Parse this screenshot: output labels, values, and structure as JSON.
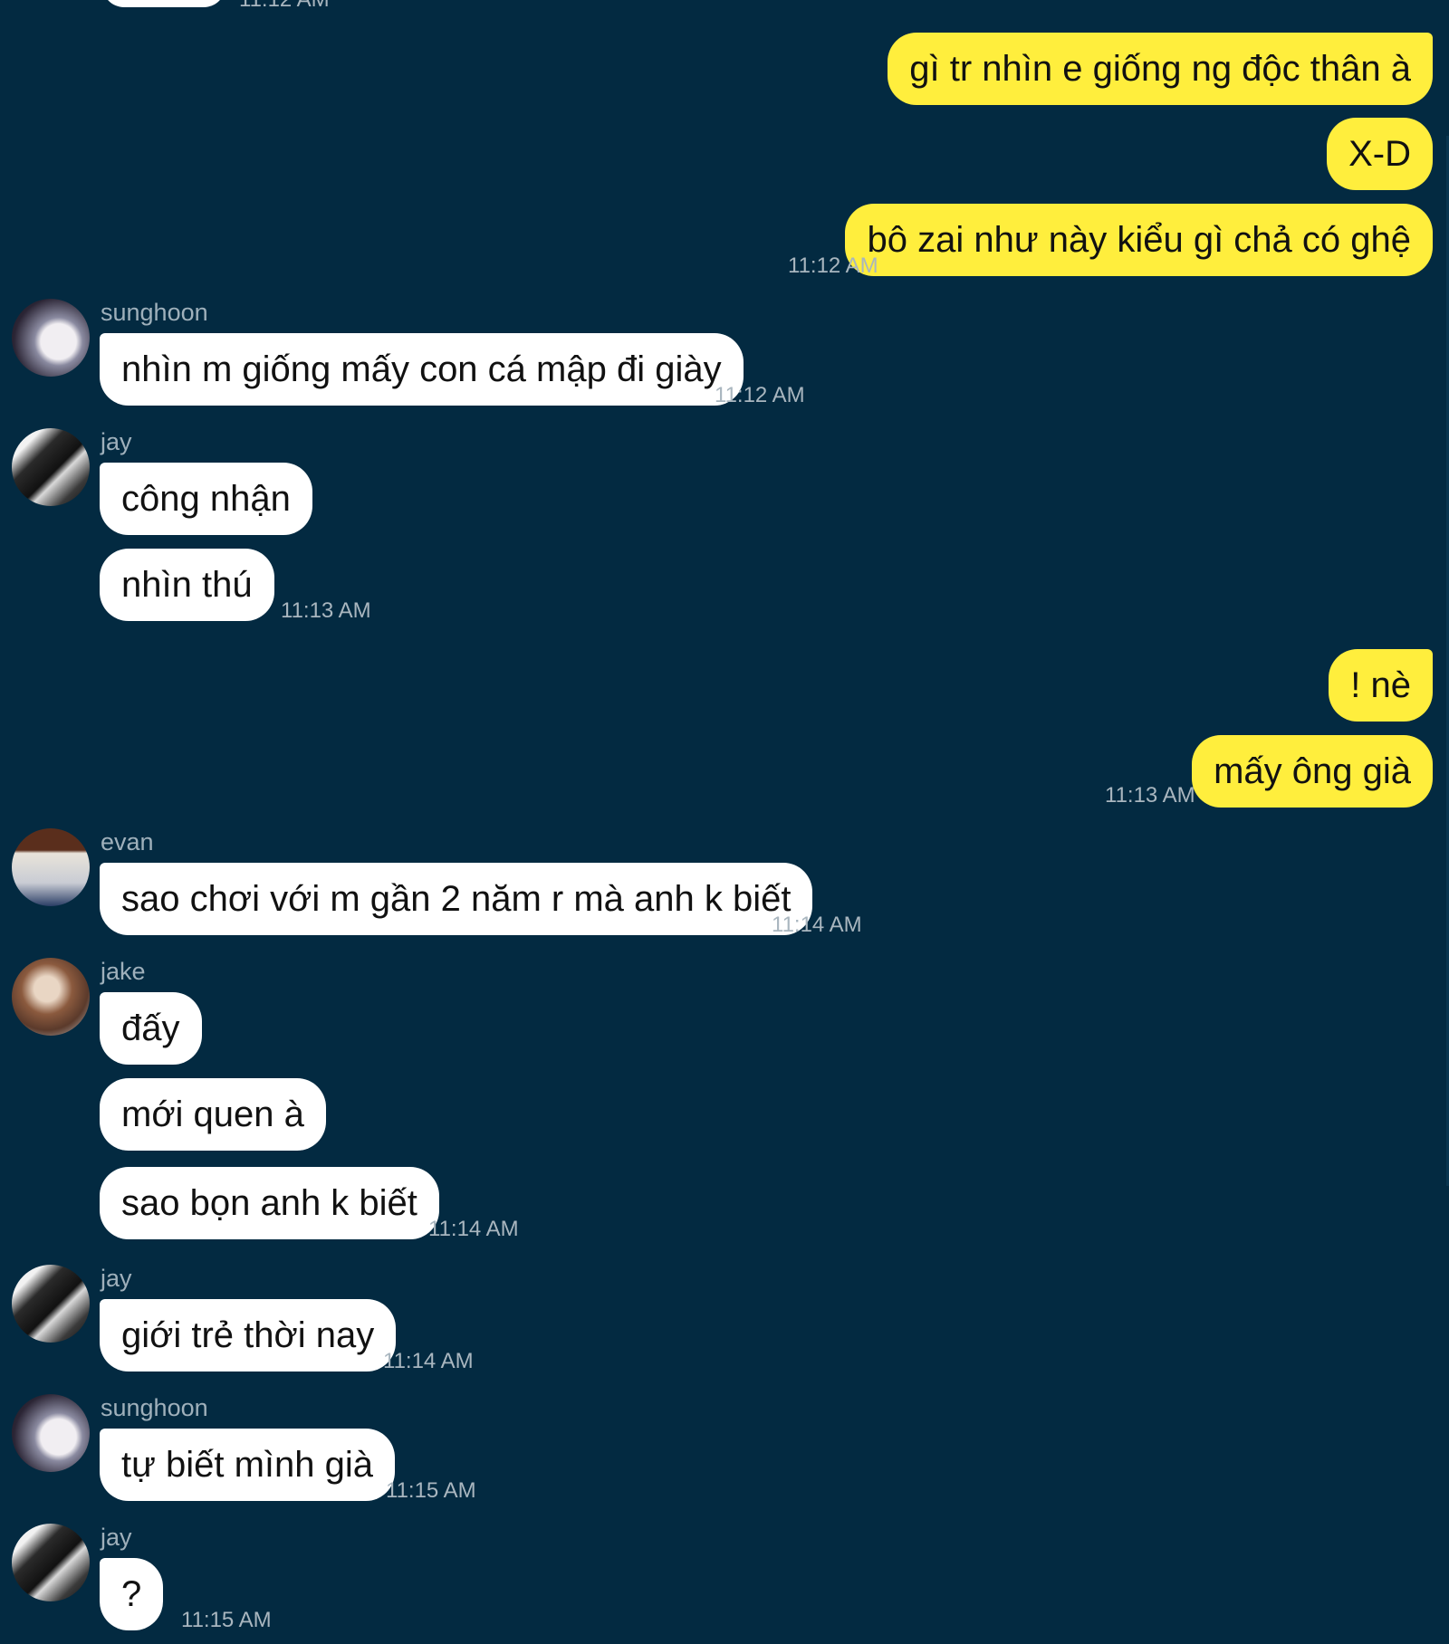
{
  "top_partial": {
    "time": "11:12 AM"
  },
  "messages": [
    {
      "side": "out",
      "text": "gì tr nhìn e giống ng độc thân à"
    },
    {
      "side": "out",
      "text": "X-D"
    },
    {
      "side": "out",
      "text": "bô zai như này kiểu gì chả có ghệ",
      "time": "11:12 AM"
    },
    {
      "side": "in",
      "sender": "sunghoon",
      "text": "nhìn m giống mấy con cá mập đi giày",
      "time": "11:12 AM"
    },
    {
      "side": "in",
      "sender": "jay",
      "text": "công nhận"
    },
    {
      "side": "in",
      "text": "nhìn thú",
      "time": "11:13 AM"
    },
    {
      "side": "out",
      "text": "! nè"
    },
    {
      "side": "out",
      "text": "mấy ông già",
      "time": "11:13 AM"
    },
    {
      "side": "in",
      "sender": "evan",
      "text": "sao chơi với m gần 2 năm r mà anh k biết",
      "time": "11:14 AM"
    },
    {
      "side": "in",
      "sender": "jake",
      "text": "đấy"
    },
    {
      "side": "in",
      "text": "mới quen à"
    },
    {
      "side": "in",
      "text": "sao bọn anh k biết",
      "time": "11:14 AM"
    },
    {
      "side": "in",
      "sender": "jay",
      "text": "giới trẻ thời nay",
      "time": "11:14 AM"
    },
    {
      "side": "in",
      "sender": "sunghoon",
      "text": "tự biết mình già",
      "time": "11:15 AM"
    },
    {
      "side": "in",
      "sender": "jay",
      "text": "?",
      "time": "11:15 AM"
    }
  ],
  "avatars": {
    "sunghoon": "sunghoon-avatar",
    "jay": "jay-avatar",
    "evan": "evan-avatar",
    "jake": "jake-avatar"
  },
  "colors": {
    "background": "#032a41",
    "incoming_bubble": "#ffffff",
    "outgoing_bubble": "#ffee3d",
    "timestamp": "#a9b6bf",
    "sender_name": "#9fb0bb"
  }
}
